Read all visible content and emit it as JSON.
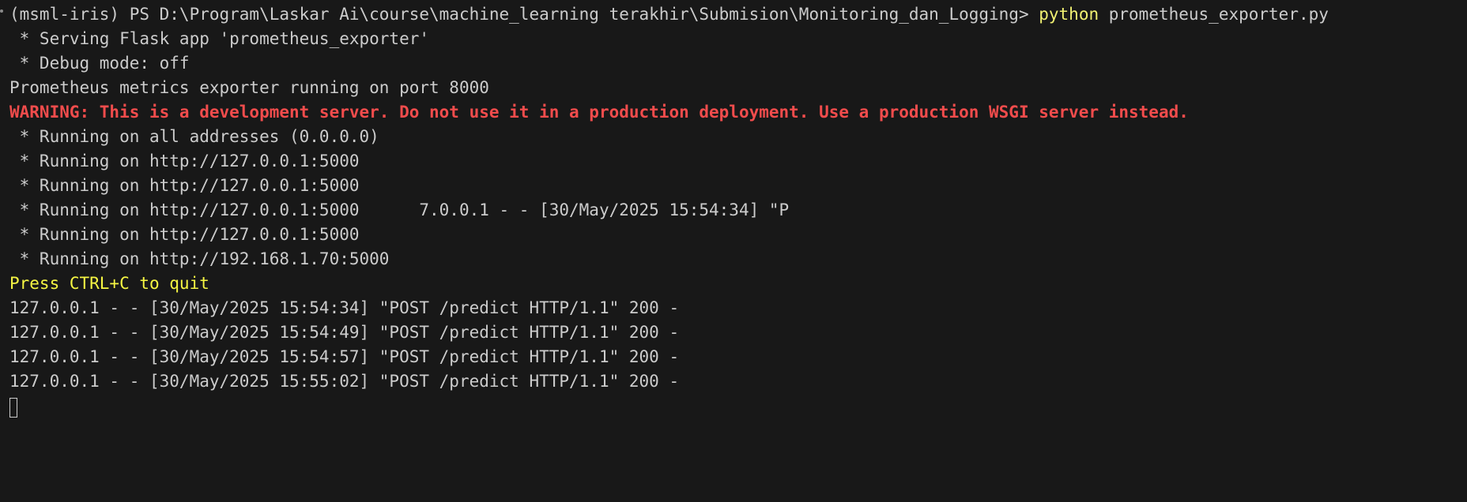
{
  "terminal": {
    "prompt": "(msml-iris) PS D:\\Program\\Laskar Ai\\course\\machine_learning terakhir\\Submision\\Monitoring_dan_Logging> ",
    "command": "python",
    "command_args": " prometheus_exporter.py",
    "lines": [
      " * Serving Flask app 'prometheus_exporter'",
      " * Debug mode: off",
      "Prometheus metrics exporter running on port 8000"
    ],
    "warning": "WARNING: This is a development server. Do not use it in a production deployment. Use a production WSGI server instead.",
    "running_lines": [
      " * Running on all addresses (0.0.0.0)",
      " * Running on http://127.0.0.1:5000",
      " * Running on http://127.0.0.1:5000",
      " * Running on http://127.0.0.1:5000      7.0.0.1 - - [30/May/2025 15:54:34] \"P",
      " * Running on http://127.0.0.1:5000",
      " * Running on http://192.168.1.70:5000"
    ],
    "quit_hint": "Press CTRL+C to quit",
    "request_log": [
      "127.0.0.1 - - [30/May/2025 15:54:34] \"POST /predict HTTP/1.1\" 200 -",
      "127.0.0.1 - - [30/May/2025 15:54:49] \"POST /predict HTTP/1.1\" 200 -",
      "127.0.0.1 - - [30/May/2025 15:54:57] \"POST /predict HTTP/1.1\" 200 -",
      "127.0.0.1 - - [30/May/2025 15:55:02] \"POST /predict HTTP/1.1\" 200 -"
    ]
  },
  "colors": {
    "background": "#181818",
    "text": "#cccccc",
    "command": "#f1f172",
    "warning": "#f14c4c",
    "hint": "#f5f543"
  }
}
